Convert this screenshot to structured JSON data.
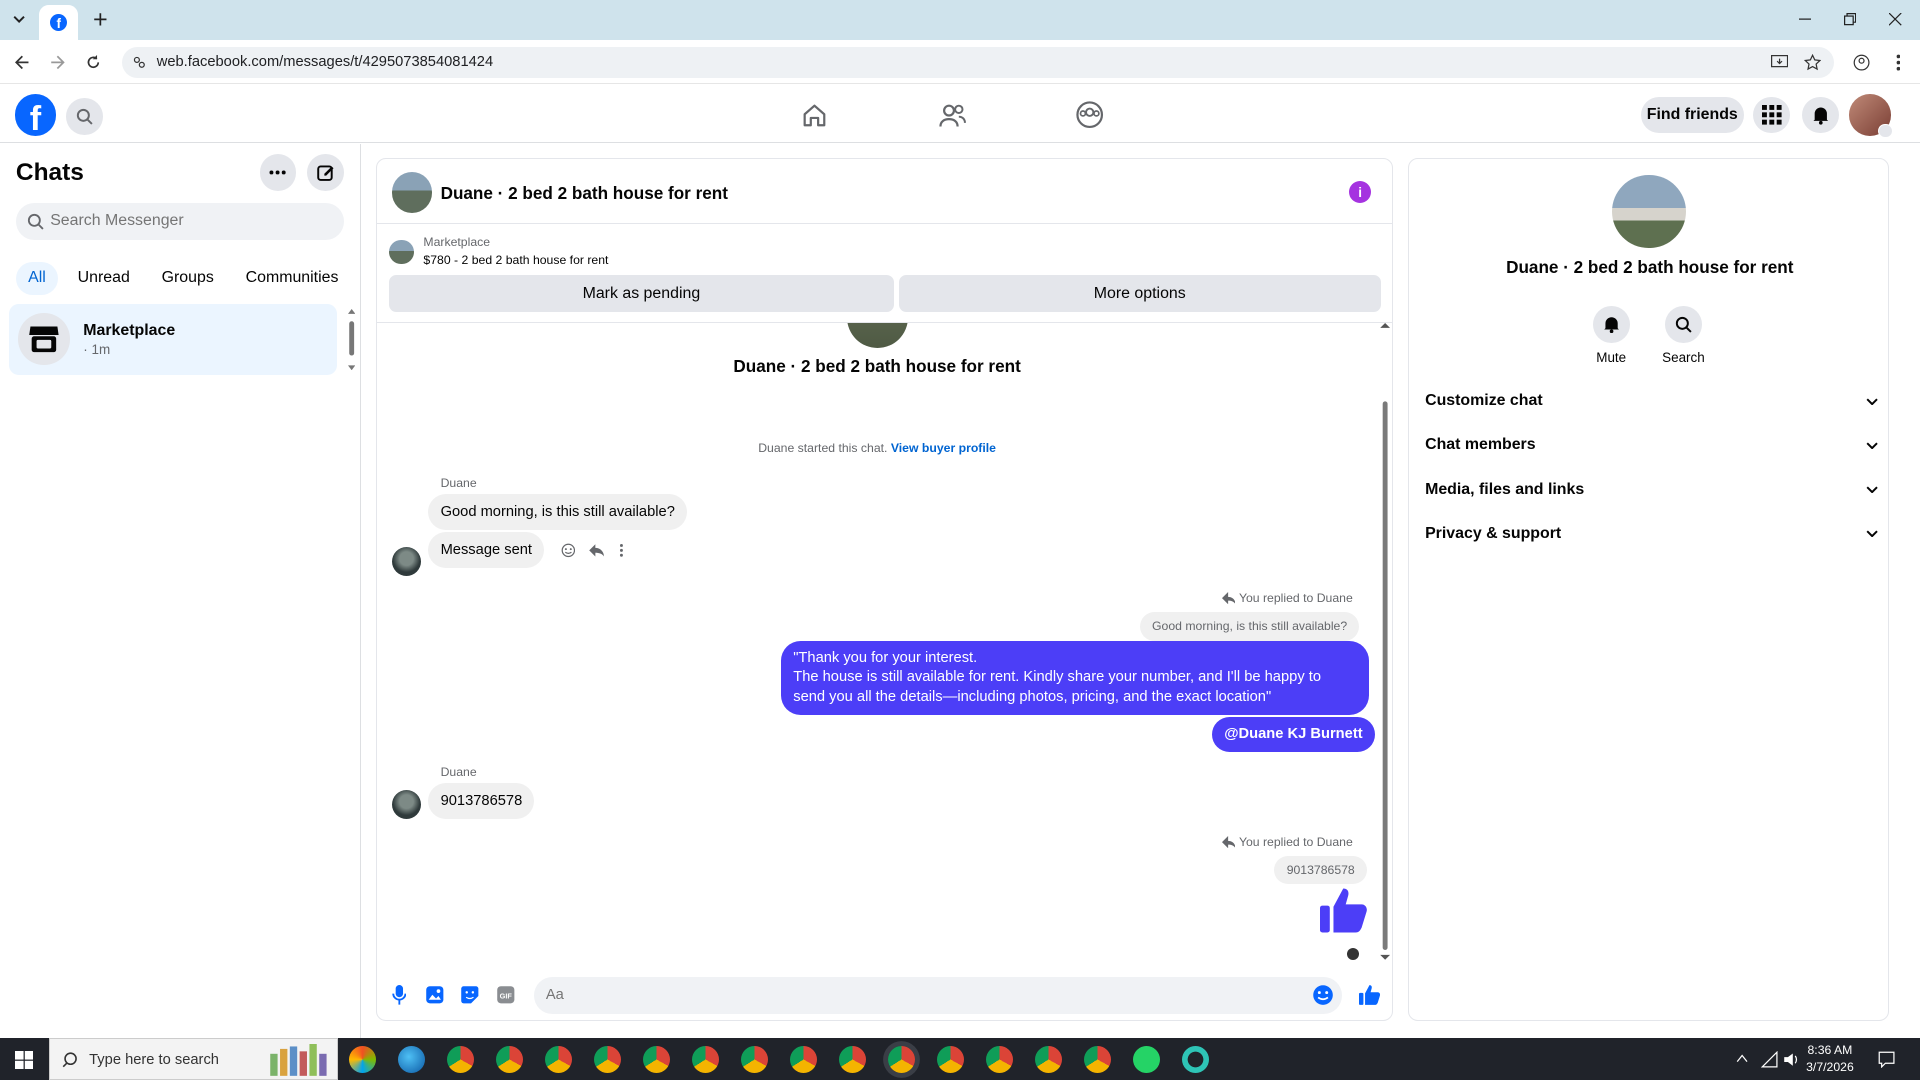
{
  "browser": {
    "url": "web.facebook.com/messages/t/4295073854081424"
  },
  "header": {
    "find_friends": "Find friends"
  },
  "sidebar": {
    "title": "Chats",
    "search_placeholder": "Search Messenger",
    "filters": [
      "All",
      "Unread",
      "Groups",
      "Communities"
    ],
    "active_filter": "All",
    "chat": {
      "name": "Marketplace",
      "time": "· 1m"
    }
  },
  "conversation": {
    "title": "Duane · 2 bed 2 bath house for rent",
    "marketplace_label": "Marketplace",
    "listing": "$780 - 2 bed 2 bath house for rent",
    "mark_pending": "Mark as pending",
    "more_options": "More options",
    "started_text": "Duane started this chat.",
    "view_buyer_profile": "View buyer profile",
    "sender_name": "Duane",
    "msg1": "Good morning, is this still available?",
    "msg2": "Message sent",
    "reply_label": "You replied to Duane",
    "quoted1": "Good morning, is this still available?",
    "out1_line1": "\"Thank you for your interest.",
    "out1_line2": "The house is still available for rent. Kindly share your number, and I'll be happy to",
    "out1_line3": "send you all the details—including photos, pricing, and the exact location\"",
    "out2": "@Duane KJ Burnett",
    "msg3": "9013786578",
    "quoted2": "9013786578",
    "composer_placeholder": "Aa"
  },
  "details": {
    "name": "Duane · 2 bed 2 bath house for rent",
    "mute": "Mute",
    "search": "Search",
    "sections": [
      "Customize chat",
      "Chat members",
      "Media, files and links",
      "Privacy & support"
    ]
  },
  "taskbar": {
    "search_placeholder": "Type here to search",
    "time": "8:36 AM",
    "date": "3/7/2026"
  },
  "colors": {
    "accent": "#0866ff",
    "outgoing_bubble": "#4c3ef7",
    "info_badge": "#a533e0"
  }
}
